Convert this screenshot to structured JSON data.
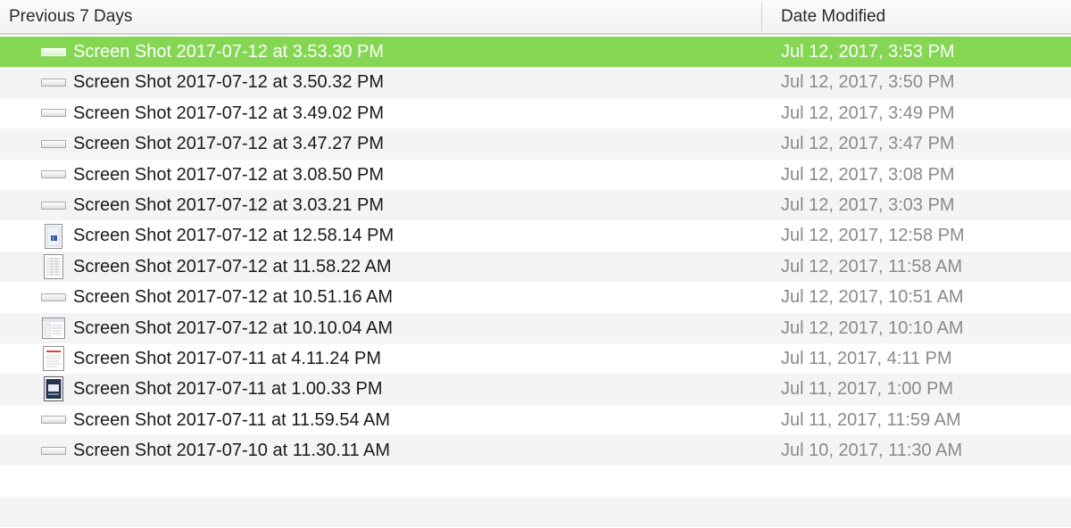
{
  "header": {
    "name_column": "Previous 7 Days",
    "date_column": "Date Modified"
  },
  "colors": {
    "selection": "#85d653",
    "alt_row": "#f4f4f4",
    "date_text": "#8a8a8a"
  },
  "files": [
    {
      "name": "Screen Shot 2017-07-12 at 3.53.30 PM",
      "date": "Jul 12, 2017, 3:53 PM",
      "icon": "wide-screenshot-icon",
      "selected": true
    },
    {
      "name": "Screen Shot 2017-07-12 at 3.50.32 PM",
      "date": "Jul 12, 2017, 3:50 PM",
      "icon": "wide-screenshot-icon",
      "selected": false
    },
    {
      "name": "Screen Shot 2017-07-12 at 3.49.02 PM",
      "date": "Jul 12, 2017, 3:49 PM",
      "icon": "wide-screenshot-icon",
      "selected": false
    },
    {
      "name": "Screen Shot 2017-07-12 at 3.47.27 PM",
      "date": "Jul 12, 2017, 3:47 PM",
      "icon": "wide-screenshot-icon",
      "selected": false
    },
    {
      "name": "Screen Shot 2017-07-12 at 3.08.50 PM",
      "date": "Jul 12, 2017, 3:08 PM",
      "icon": "wide-screenshot-icon",
      "selected": false
    },
    {
      "name": "Screen Shot 2017-07-12 at 3.03.21 PM",
      "date": "Jul 12, 2017, 3:03 PM",
      "icon": "wide-screenshot-icon",
      "selected": false
    },
    {
      "name": "Screen Shot 2017-07-12 at 12.58.14 PM",
      "date": "Jul 12, 2017, 12:58 PM",
      "icon": "phone-screenshot-icon",
      "selected": false
    },
    {
      "name": "Screen Shot 2017-07-12 at 11.58.22 AM",
      "date": "Jul 12, 2017, 11:58 AM",
      "icon": "spreadsheet-screenshot-icon",
      "selected": false
    },
    {
      "name": "Screen Shot 2017-07-12 at 10.51.16 AM",
      "date": "Jul 12, 2017, 10:51 AM",
      "icon": "wide-screenshot-icon",
      "selected": false
    },
    {
      "name": "Screen Shot 2017-07-12 at 10.10.04 AM",
      "date": "Jul 12, 2017, 10:10 AM",
      "icon": "window-screenshot-icon",
      "selected": false
    },
    {
      "name": "Screen Shot 2017-07-11 at 4.11.24 PM",
      "date": "Jul 11, 2017, 4:11 PM",
      "icon": "document-screenshot-icon",
      "selected": false
    },
    {
      "name": "Screen Shot 2017-07-11 at 1.00.33 PM",
      "date": "Jul 11, 2017, 1:00 PM",
      "icon": "dark-window-screenshot-icon",
      "selected": false
    },
    {
      "name": "Screen Shot 2017-07-11 at 11.59.54 AM",
      "date": "Jul 11, 2017, 11:59 AM",
      "icon": "wide-screenshot-icon",
      "selected": false
    },
    {
      "name": "Screen Shot 2017-07-10 at 11.30.11 AM",
      "date": "Jul 10, 2017, 11:30 AM",
      "icon": "wide-screenshot-icon",
      "selected": false
    }
  ]
}
